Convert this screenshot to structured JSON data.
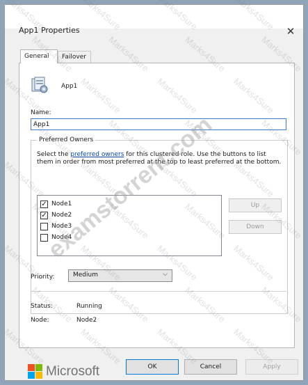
{
  "window": {
    "title": "App1 Properties",
    "close_glyph": "✕"
  },
  "tabs": [
    {
      "label": "General",
      "active": true
    },
    {
      "label": "Failover",
      "active": false
    }
  ],
  "role": {
    "icon": "clustered-role-icon",
    "name": "App1"
  },
  "name_field": {
    "label": "Name:",
    "value": "App1"
  },
  "preferred_owners": {
    "title": "Preferred Owners",
    "desc_before": "Select the ",
    "desc_link": "preferred owners",
    "desc_after": " for this clustered role. Use the buttons to list them in order from most preferred at the top to least preferred at the bottom.",
    "nodes": [
      {
        "label": "Node1",
        "checked": true
      },
      {
        "label": "Node2",
        "checked": true
      },
      {
        "label": "Node3",
        "checked": false
      },
      {
        "label": "Node4",
        "checked": false
      }
    ],
    "up_label": "Up",
    "down_label": "Down"
  },
  "priority": {
    "label": "Priority:",
    "value": "Medium"
  },
  "status": {
    "label": "Status:",
    "value": "Running"
  },
  "node": {
    "label": "Node:",
    "value": "Node2"
  },
  "buttons": {
    "ok": "OK",
    "cancel": "Cancel",
    "apply": "Apply"
  },
  "branding": {
    "microsoft": "Microsoft"
  },
  "watermarks": {
    "small": "Marks4Sure",
    "large": "examstorrent.com"
  },
  "colors": {
    "accent": "#0078d7",
    "link": "#0645ad",
    "focus_border": "#3c78d8"
  }
}
